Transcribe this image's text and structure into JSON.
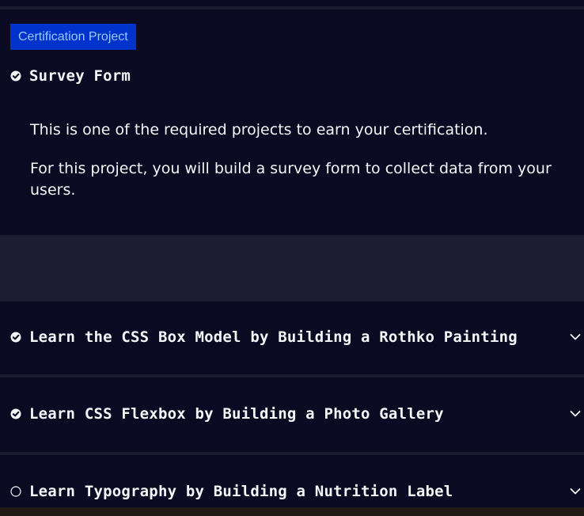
{
  "project": {
    "badge": "Certification Project",
    "title": "Survey Form",
    "completed": true,
    "description_1": "This is one of the required projects to earn your certification.",
    "description_2": "For this project, you will build a survey form to collect data from your users."
  },
  "blocks": [
    {
      "title": "Learn the CSS Box Model by Building a Rothko Painting",
      "completed": true,
      "expand_icon": "chevron-down-icon"
    },
    {
      "title": "Learn CSS Flexbox by Building a Photo Gallery",
      "completed": true,
      "expand_icon": "chevron-down-icon"
    },
    {
      "title": "Learn Typography by Building a Nutrition Label",
      "completed": false,
      "expand_icon": "chevron-down-icon"
    }
  ],
  "colors": {
    "page_bg": "#1b1b32",
    "block_bg": "#0a0a23",
    "badge_bg": "#0033cc",
    "badge_text": "#99c9ff",
    "text": "#f5f6f7"
  }
}
